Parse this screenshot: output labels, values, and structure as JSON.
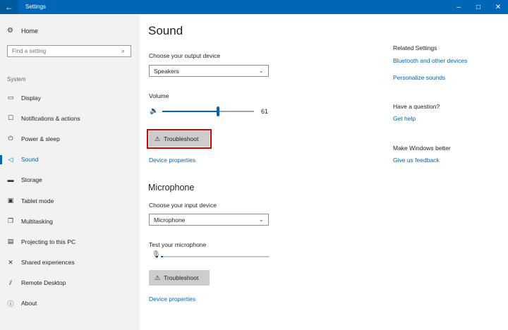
{
  "window": {
    "title": "Settings",
    "back_glyph": "←",
    "controls": {
      "minimize": "–",
      "maximize": "□",
      "close": "✕"
    }
  },
  "sidebar": {
    "home": {
      "label": "Home",
      "icon": "gear-icon",
      "glyph": "⚙"
    },
    "search": {
      "placeholder": "Find a setting",
      "icon": "search-icon",
      "glyph": "⌕"
    },
    "section": "System",
    "items": [
      {
        "label": "Display",
        "icon": "display-icon",
        "glyph": "▭",
        "active": false
      },
      {
        "label": "Notifications & actions",
        "icon": "notifications-icon",
        "glyph": "☐",
        "active": false
      },
      {
        "label": "Power & sleep",
        "icon": "power-icon",
        "glyph": "⏻",
        "active": false
      },
      {
        "label": "Sound",
        "icon": "speaker-icon",
        "glyph": "◁",
        "active": true
      },
      {
        "label": "Storage",
        "icon": "storage-icon",
        "glyph": "▬",
        "active": false
      },
      {
        "label": "Tablet mode",
        "icon": "tablet-icon",
        "glyph": "▣",
        "active": false
      },
      {
        "label": "Multitasking",
        "icon": "multitasking-icon",
        "glyph": "❐",
        "active": false
      },
      {
        "label": "Projecting to this PC",
        "icon": "projector-icon",
        "glyph": "▤",
        "active": false
      },
      {
        "label": "Shared experiences",
        "icon": "shared-icon",
        "glyph": "✕",
        "active": false
      },
      {
        "label": "Remote Desktop",
        "icon": "remote-desktop-icon",
        "glyph": "⫽",
        "active": false
      },
      {
        "label": "About",
        "icon": "info-icon",
        "glyph": "ⓘ",
        "active": false
      }
    ]
  },
  "main": {
    "title": "Sound",
    "output": {
      "label": "Choose your output device",
      "value": "Speakers",
      "volume_label": "Volume",
      "volume_value": "61",
      "volume_fraction": 0.61,
      "troubleshoot": "Troubleshoot",
      "device_properties": "Device properties"
    },
    "microphone": {
      "heading": "Microphone",
      "label": "Choose your input device",
      "value": "Microphone",
      "test_label": "Test your microphone",
      "level_fraction": 0.02,
      "troubleshoot": "Troubleshoot",
      "device_properties": "Device properties"
    },
    "chevron_glyph": "⌄",
    "warning_glyph": "⚠",
    "speaker_glyph": "🔉",
    "mic_glyph": "🎙"
  },
  "related": {
    "heading": "Related Settings",
    "links": [
      "Bluetooth and other devices",
      "Personalize sounds"
    ],
    "question_heading": "Have a question?",
    "help_link": "Get help",
    "better_heading": "Make Windows better",
    "feedback_link": "Give us feedback"
  },
  "colors": {
    "accent": "#0067b8",
    "highlight": "#d50000",
    "sidebar_bg": "#f2f2f2"
  }
}
